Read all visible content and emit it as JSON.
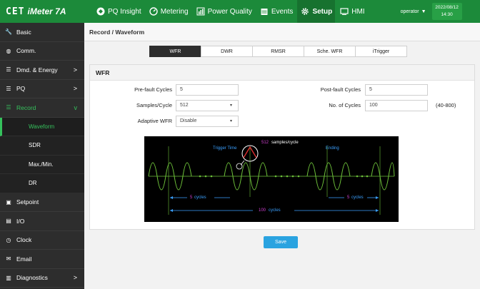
{
  "header": {
    "brand_logo": "CET",
    "product": "iMeter 7A",
    "nav": [
      {
        "label": "PQ Insight",
        "icon": "insight-icon"
      },
      {
        "label": "Metering",
        "icon": "gauge-icon"
      },
      {
        "label": "Power Quality",
        "icon": "bar-chart-icon"
      },
      {
        "label": "Events",
        "icon": "calendar-icon"
      },
      {
        "label": "Setup",
        "icon": "gear-icon"
      },
      {
        "label": "HMI",
        "icon": "monitor-icon"
      }
    ],
    "user": "operator",
    "date": "2022/08/12",
    "time": "14:30"
  },
  "sidebar": {
    "items": [
      {
        "label": "Basic",
        "icon": "wrench-icon"
      },
      {
        "label": "Comm.",
        "icon": "globe-icon"
      },
      {
        "label": "Dmd. & Energy",
        "icon": "list-icon",
        "arrow": ">"
      },
      {
        "label": "PQ",
        "icon": "list-icon",
        "arrow": ">"
      },
      {
        "label": "Record",
        "icon": "list-icon",
        "arrow": "v"
      },
      {
        "label": "Setpoint",
        "icon": "setpoint-icon"
      },
      {
        "label": "I/O",
        "icon": "io-icon"
      },
      {
        "label": "Clock",
        "icon": "clock-icon"
      },
      {
        "label": "Email",
        "icon": "mail-icon"
      },
      {
        "label": "Diagnostics",
        "icon": "diagnostics-icon",
        "arrow": ">"
      }
    ],
    "record_sub": [
      "Waveform",
      "SDR",
      "Max./Min.",
      "DR"
    ]
  },
  "main": {
    "breadcrumb": "Record / Waveform",
    "tabs": [
      "WFR",
      "DWR",
      "RMSR",
      "Sche. WFR",
      "iTrigger"
    ],
    "panel_title": "WFR",
    "fields": {
      "prefault_label": "Pre-fault Cycles",
      "prefault_value": "5",
      "postfault_label": "Post-fault Cycles",
      "postfault_value": "5",
      "samples_label": "Samples/Cycle",
      "samples_value": "512",
      "cycles_label": "No. of Cycles",
      "cycles_value": "100",
      "cycles_hint": "(40-800)",
      "adaptive_label": "Adaptive WFR",
      "adaptive_value": "Disable"
    },
    "diagram": {
      "trigger_time": "Trigger Time",
      "samples_num": "512",
      "samples_text": "samples/cycle",
      "ending": "Ending",
      "pre_cycles_num": "5",
      "pre_cycles_text": "cycles",
      "post_cycles_num": "5",
      "post_cycles_text": "cycles",
      "total_cycles_num": "100",
      "total_cycles_text": "cycles"
    },
    "save_label": "Save"
  },
  "colors": {
    "header_green": "#1c8a3a",
    "accent_green": "#35c15c",
    "sidebar_dark": "#2d2d2d",
    "save_blue": "#2aa3e0",
    "wave_green": "#6ec23a",
    "annotation_magenta": "#d040d0"
  }
}
